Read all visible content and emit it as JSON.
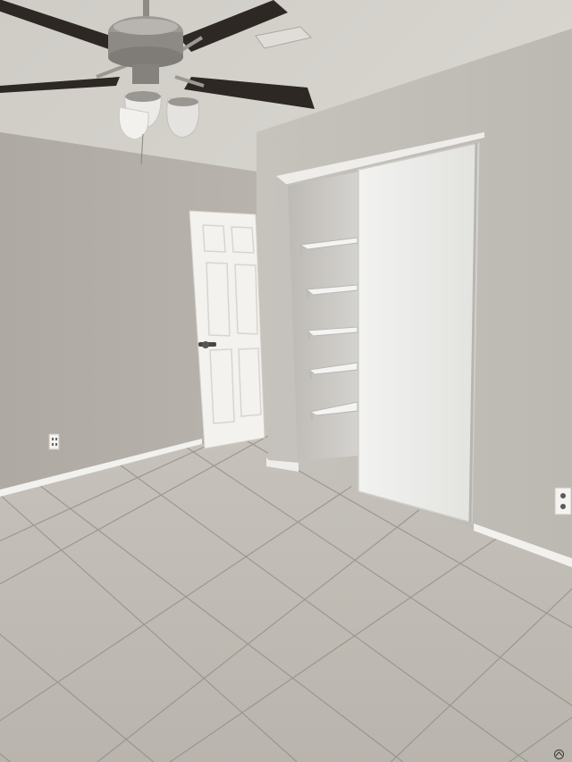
{
  "image": {
    "description_kind": "photo",
    "colors": {
      "ceiling": "#d2cfc9",
      "wall_left": "#b1aca5",
      "wall_right": "#c0bcb6",
      "closet_door": "#ececea",
      "room_door": "#f3f2ee",
      "floor": "#bdb8b1",
      "grout": "#8a8680",
      "baseboard": "#f2f1ee"
    },
    "icons": [
      "ceiling-fan-icon",
      "logo-icon"
    ]
  },
  "watermark": {
    "line1": "",
    "line2": ""
  }
}
